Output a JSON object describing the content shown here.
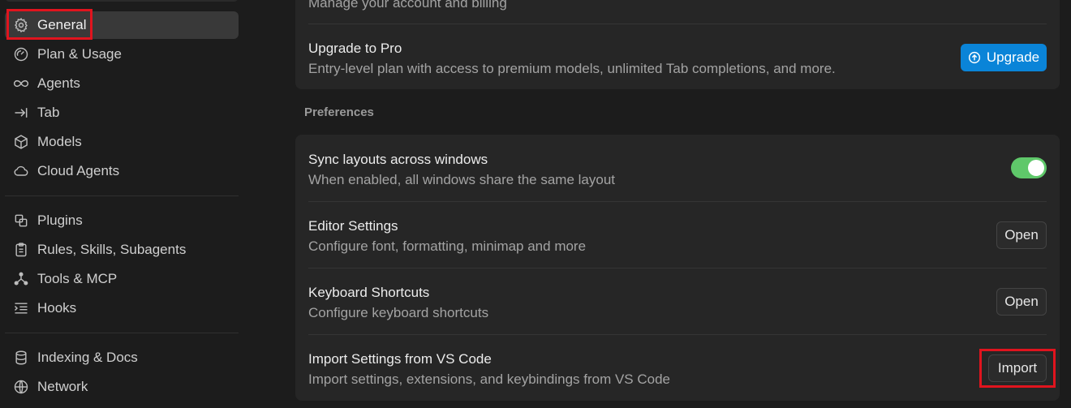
{
  "sidebar": {
    "groups": [
      {
        "items": [
          {
            "label": "General",
            "icon": "gear-icon",
            "active": true
          },
          {
            "label": "Plan & Usage",
            "icon": "gauge-icon"
          },
          {
            "label": "Agents",
            "icon": "infinity-icon"
          },
          {
            "label": "Tab",
            "icon": "tab-arrow-icon"
          },
          {
            "label": "Models",
            "icon": "cube-icon"
          },
          {
            "label": "Cloud Agents",
            "icon": "cloud-icon"
          }
        ]
      },
      {
        "items": [
          {
            "label": "Plugins",
            "icon": "plugin-icon"
          },
          {
            "label": "Rules, Skills, Subagents",
            "icon": "clipboard-icon"
          },
          {
            "label": "Tools & MCP",
            "icon": "network-nodes-icon"
          },
          {
            "label": "Hooks",
            "icon": "list-indent-icon"
          }
        ]
      },
      {
        "items": [
          {
            "label": "Indexing & Docs",
            "icon": "database-icon"
          },
          {
            "label": "Network",
            "icon": "globe-icon"
          }
        ]
      }
    ]
  },
  "main": {
    "account_card": {
      "partial_desc": "Manage your account and billing",
      "upgrade": {
        "title": "Upgrade to Pro",
        "desc": "Entry-level plan with access to premium models, unlimited Tab completions, and more.",
        "button": "Upgrade"
      }
    },
    "preferences": {
      "label": "Preferences",
      "rows": [
        {
          "title": "Sync layouts across windows",
          "desc": "When enabled, all windows share the same layout",
          "control": "toggle",
          "value": true
        },
        {
          "title": "Editor Settings",
          "desc": "Configure font, formatting, minimap and more",
          "control": "button",
          "button": "Open"
        },
        {
          "title": "Keyboard Shortcuts",
          "desc": "Configure keyboard shortcuts",
          "control": "button",
          "button": "Open"
        },
        {
          "title": "Import Settings from VS Code",
          "desc": "Import settings, extensions, and keybindings from VS Code",
          "control": "button",
          "button": "Import"
        }
      ]
    }
  },
  "colors": {
    "accent": "#0a84d8",
    "toggle_on": "#5fc86a",
    "highlight": "#e0141e"
  }
}
